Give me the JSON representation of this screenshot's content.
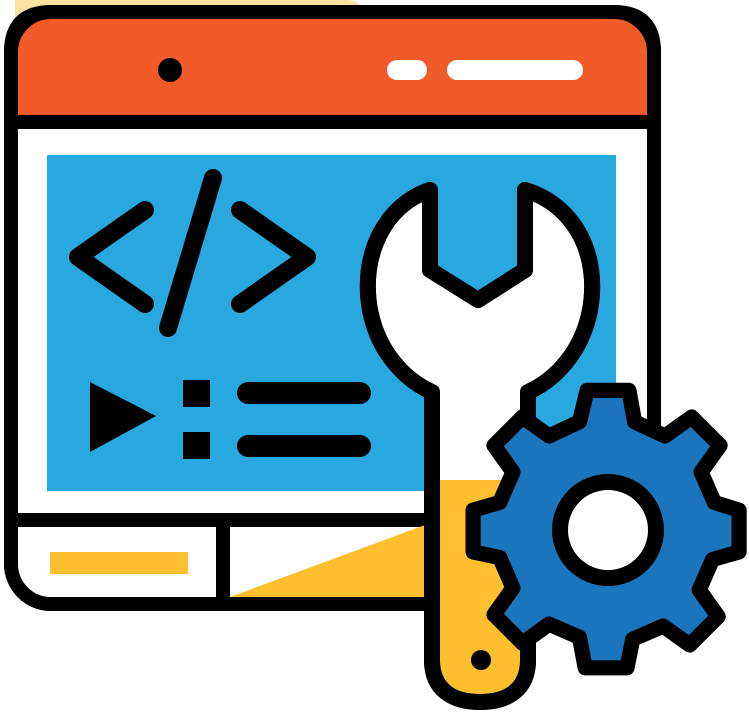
{
  "illustration": {
    "subject": [
      "browser-window",
      "code-tag-icon",
      "play-icon",
      "list-icon",
      "wrench-icon",
      "gear-icon"
    ],
    "colors": {
      "outline": "#000000",
      "title_bar": "#f15a29",
      "code_panel": "#29a8e0",
      "accent_yellow": "#fdbf2d",
      "blob_light_yellow": "#fde3a3",
      "gear_blue": "#1b75bc",
      "window_white": "#ffffff"
    }
  }
}
